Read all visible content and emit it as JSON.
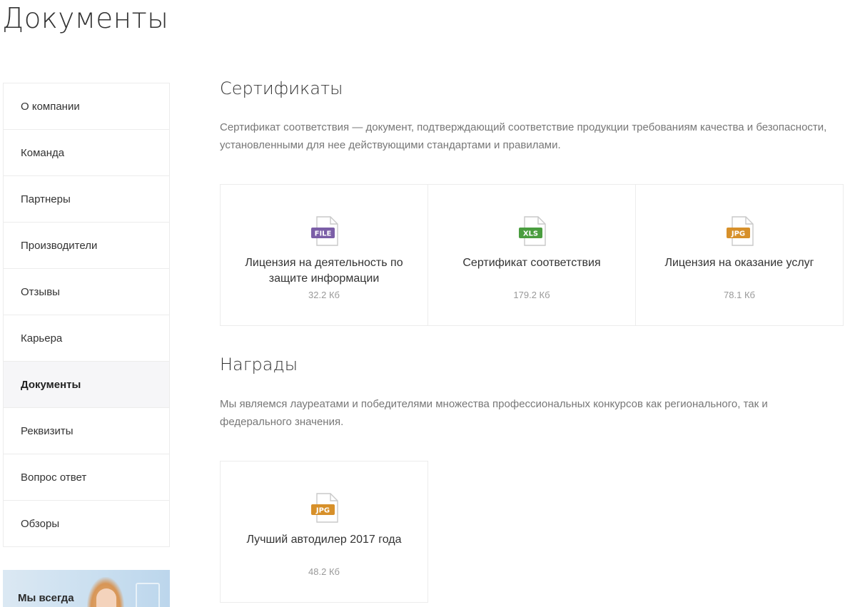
{
  "page_title": "Документы",
  "sidebar": {
    "items": [
      {
        "label": "О компании",
        "active": false
      },
      {
        "label": "Команда",
        "active": false
      },
      {
        "label": "Партнеры",
        "active": false
      },
      {
        "label": "Производители",
        "active": false
      },
      {
        "label": "Отзывы",
        "active": false
      },
      {
        "label": "Карьера",
        "active": false
      },
      {
        "label": "Документы",
        "active": true
      },
      {
        "label": "Реквизиты",
        "active": false
      },
      {
        "label": "Вопрос ответ",
        "active": false
      },
      {
        "label": "Обзоры",
        "active": false
      }
    ]
  },
  "banner": {
    "text": "Мы всегда"
  },
  "sections": [
    {
      "title": "Сертификаты",
      "description": "Сертификат соответствия — документ, подтверждающий соответствие продукции требованиям качества и безопасности, установленными для нее действующими стандартами и правилами.",
      "files": [
        {
          "type": "FILE",
          "color": "#7b5ea7",
          "name": "Лицензия на деятельность по защите информации",
          "size": "32.2 Кб"
        },
        {
          "type": "XLS",
          "color": "#4a9d3f",
          "name": "Сертификат соответствия",
          "size": "179.2 Кб"
        },
        {
          "type": "JPG",
          "color": "#d7902a",
          "name": "Лицензия на оказание услуг",
          "size": "78.1 Кб"
        }
      ]
    },
    {
      "title": "Награды",
      "description": "Мы являемся лауреатами и победителями множества профессиональных конкурсов как регионального, так и федерального значения.",
      "files": [
        {
          "type": "JPG",
          "color": "#d7902a",
          "name": "Лучший автодилер 2017 года",
          "size": "48.2 Кб"
        }
      ]
    }
  ]
}
